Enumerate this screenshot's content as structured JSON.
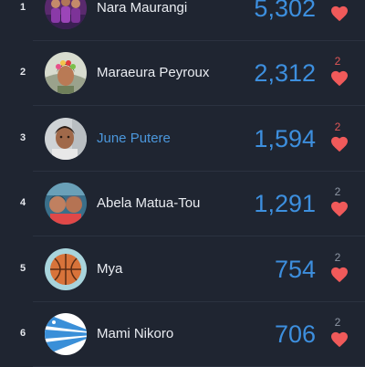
{
  "leaderboard": [
    {
      "rank": "1",
      "name": "Nara Maurangi",
      "score": "5,302",
      "likes": "",
      "highlighted": false,
      "likes_hot": false,
      "avatar_icon": "group-photo-avatar"
    },
    {
      "rank": "2",
      "name": "Maraeura Peyroux",
      "score": "2,312",
      "likes": "2",
      "highlighted": false,
      "likes_hot": true,
      "avatar_icon": "flower-crown-avatar"
    },
    {
      "rank": "3",
      "name": "June Putere",
      "score": "1,594",
      "likes": "2",
      "highlighted": true,
      "likes_hot": true,
      "avatar_icon": "portrait-avatar"
    },
    {
      "rank": "4",
      "name": "Abela Matua-Tou",
      "score": "1,291",
      "likes": "2",
      "highlighted": false,
      "likes_hot": false,
      "avatar_icon": "selfie-avatar"
    },
    {
      "rank": "5",
      "name": "Mya",
      "score": "754",
      "likes": "2",
      "highlighted": false,
      "likes_hot": false,
      "avatar_icon": "basketball-avatar"
    },
    {
      "rank": "6",
      "name": "Mami Nikoro",
      "score": "706",
      "likes": "2",
      "highlighted": false,
      "likes_hot": false,
      "avatar_icon": "flag-avatar"
    }
  ],
  "colors": {
    "background": "#1f2531",
    "score": "#3d8fde",
    "highlight_name": "#4b97dc",
    "heart": "#f05a5a",
    "likes_hot": "#e05757",
    "likes_muted": "#8e96a4"
  }
}
